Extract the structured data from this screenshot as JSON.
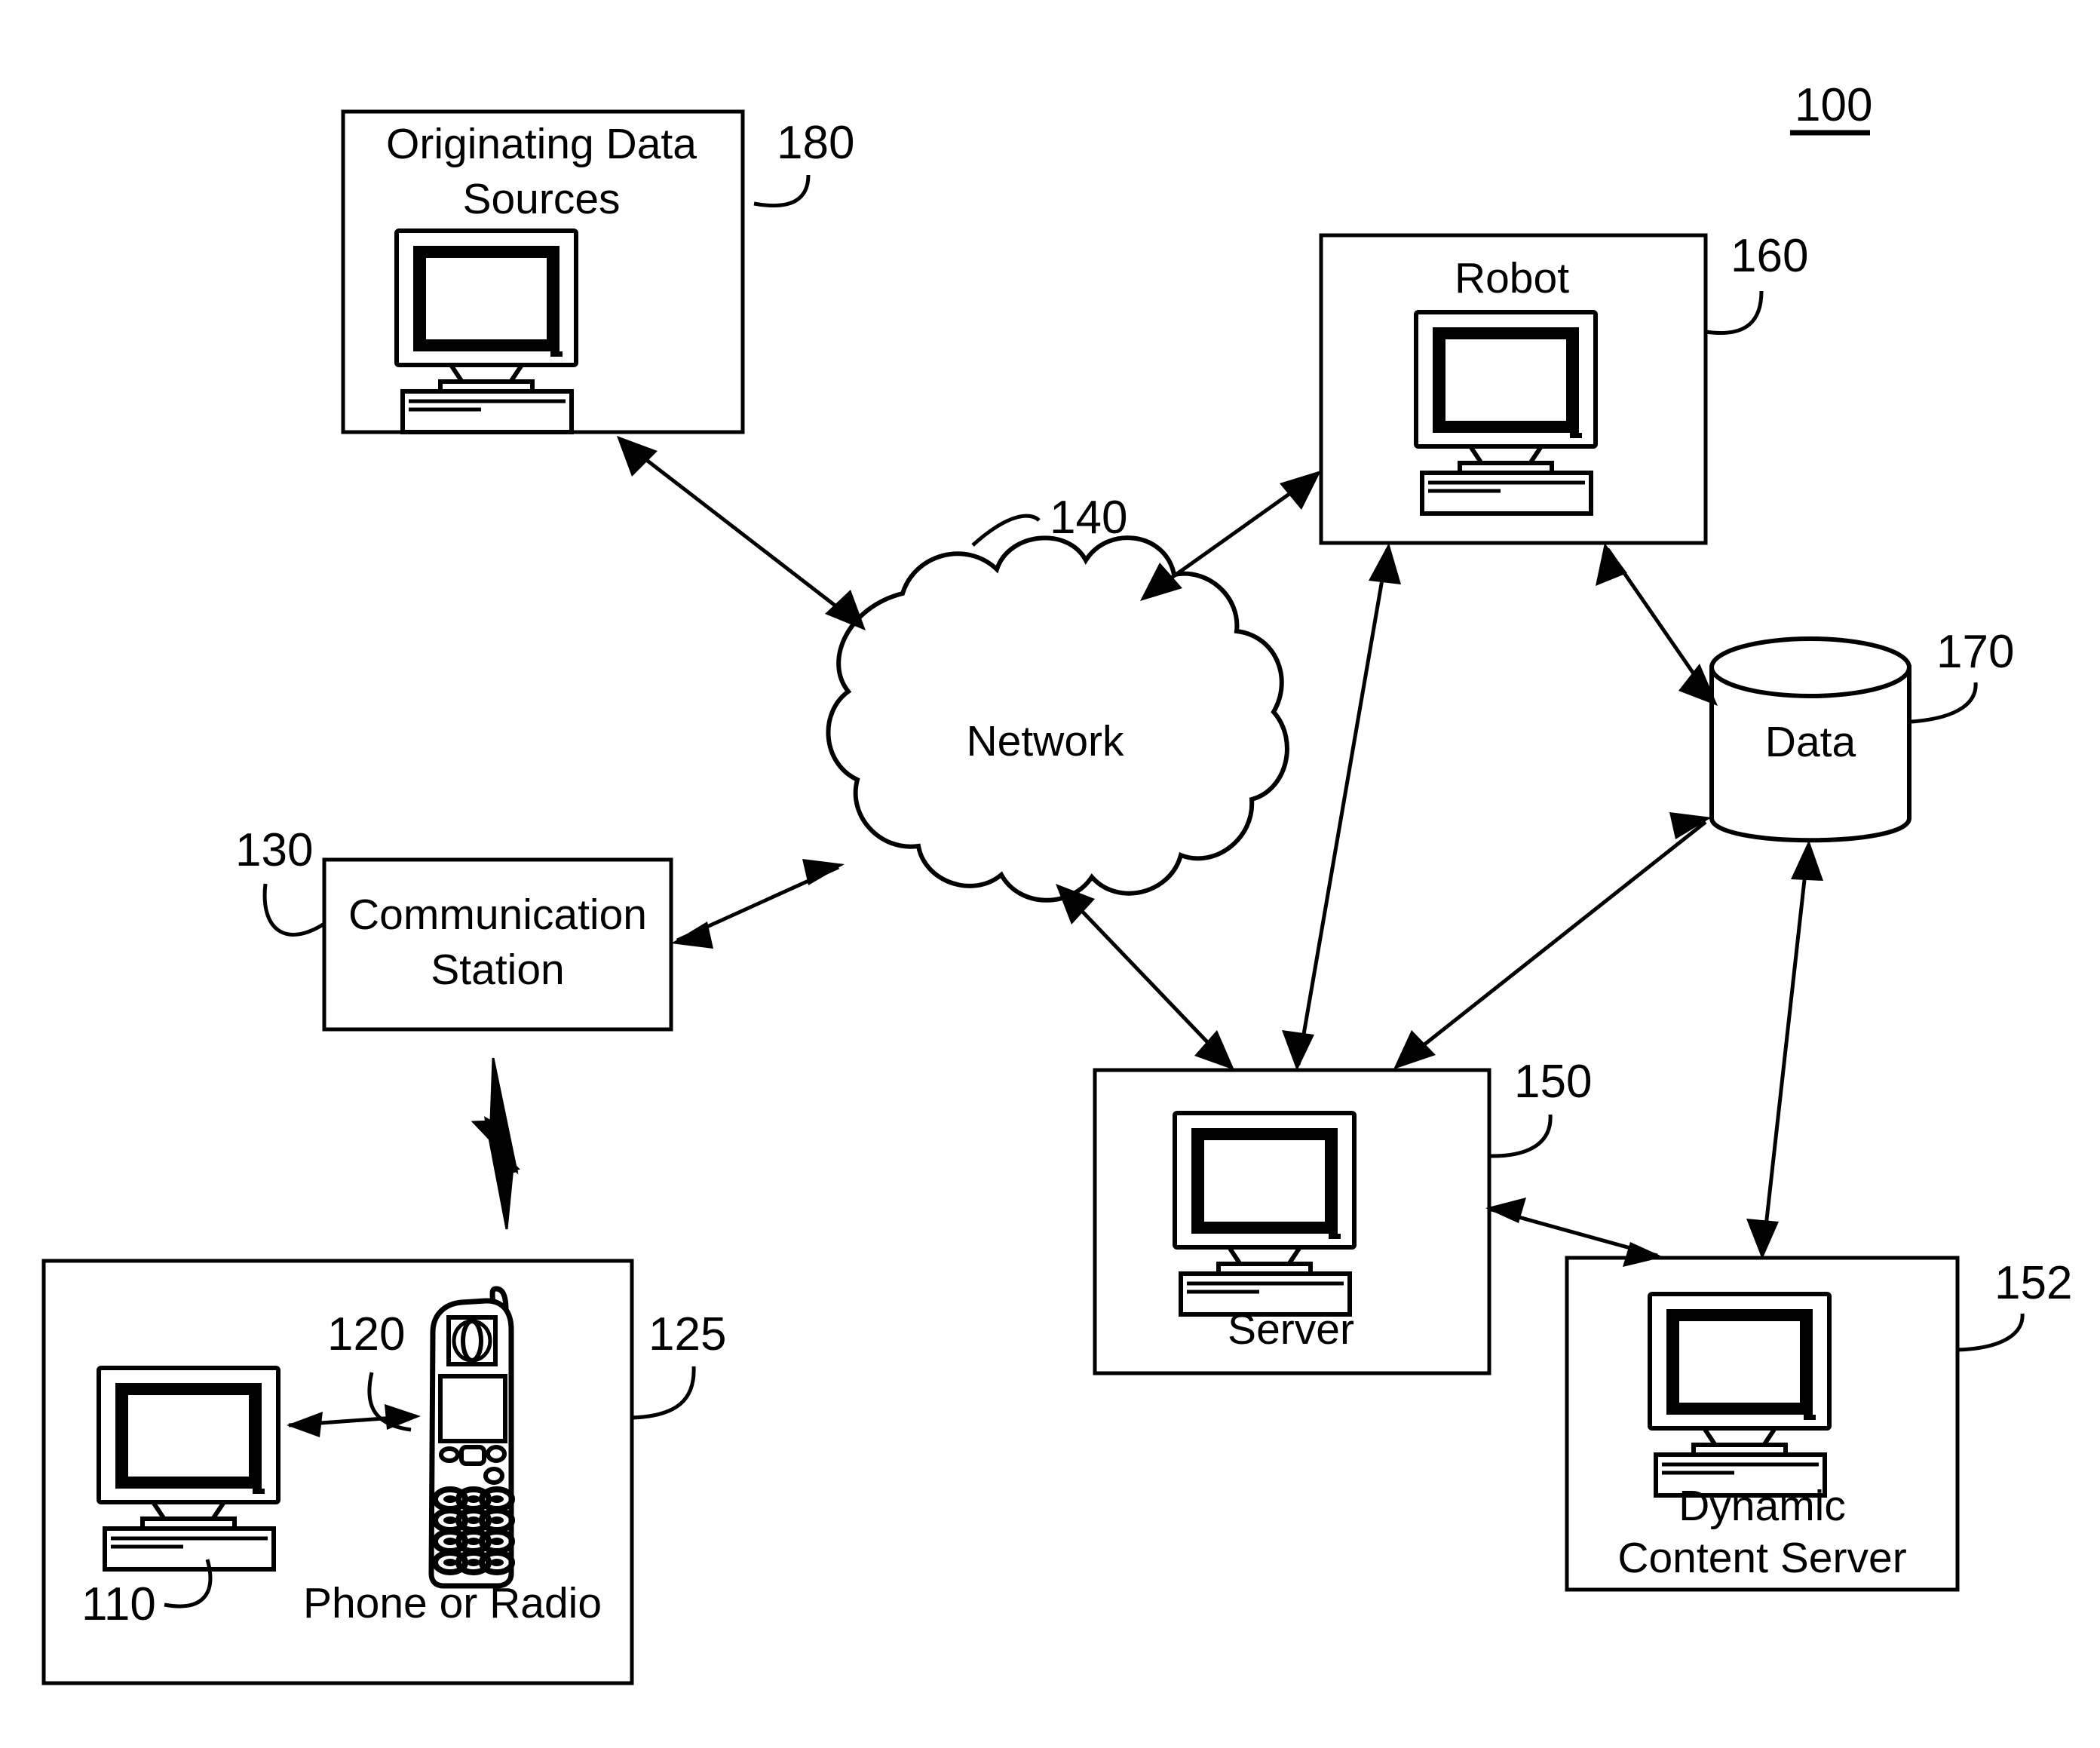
{
  "figure": {
    "number": "100"
  },
  "nodes": {
    "originating_data_sources": {
      "label_line1": "Originating Data",
      "label_line2": "Sources",
      "ref": "180",
      "icon": "desktop-computer-icon"
    },
    "robot": {
      "label": "Robot",
      "ref": "160",
      "icon": "desktop-computer-icon"
    },
    "network": {
      "label": "Network",
      "ref": "140",
      "icon": "cloud-shape"
    },
    "data_store": {
      "label": "Data",
      "ref": "170",
      "icon": "cylinder-database-icon"
    },
    "server": {
      "label": "Server",
      "ref": "150",
      "icon": "desktop-computer-icon"
    },
    "dynamic_content_server": {
      "label_line1": "Dynamic",
      "label_line2": "Content Server",
      "ref": "152",
      "icon": "desktop-computer-icon"
    },
    "communication_station": {
      "label_line1": "Communication",
      "label_line2": "Station",
      "ref": "130"
    },
    "client_group": {
      "ref": "125",
      "computer_ref": "110",
      "phone_ref": "120",
      "phone_label": "Phone or Radio",
      "computer_icon": "desktop-computer-icon",
      "phone_icon": "cell-phone-icon",
      "wireless_icon": "lightning-bolt-icon"
    }
  },
  "connections": [
    {
      "from": "originating_data_sources",
      "to": "network",
      "type": "bidirectional"
    },
    {
      "from": "network",
      "to": "robot",
      "type": "bidirectional"
    },
    {
      "from": "network",
      "to": "communication_station",
      "type": "bidirectional"
    },
    {
      "from": "network",
      "to": "server",
      "type": "bidirectional"
    },
    {
      "from": "robot",
      "to": "server",
      "type": "bidirectional"
    },
    {
      "from": "robot",
      "to": "data_store",
      "type": "bidirectional"
    },
    {
      "from": "server",
      "to": "data_store",
      "type": "bidirectional"
    },
    {
      "from": "data_store",
      "to": "dynamic_content_server",
      "type": "bidirectional"
    },
    {
      "from": "server",
      "to": "dynamic_content_server",
      "type": "bidirectional"
    },
    {
      "from": "communication_station",
      "to": "client_group",
      "type": "wireless"
    },
    {
      "from": "client_computer",
      "to": "client_phone",
      "type": "bidirectional"
    }
  ],
  "colors": {
    "ink": "#000000",
    "paper": "#ffffff"
  }
}
